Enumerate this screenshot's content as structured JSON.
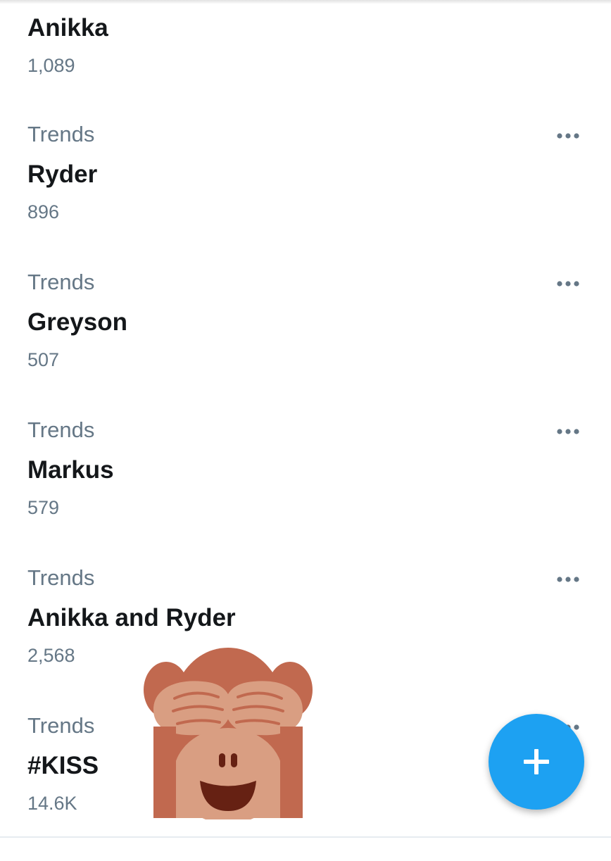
{
  "trends": [
    {
      "category": "",
      "name": "Anikka",
      "count": "1,089",
      "show_more": false
    },
    {
      "category": "Trends",
      "name": "Ryder",
      "count": "896",
      "show_more": true
    },
    {
      "category": "Trends",
      "name": "Greyson",
      "count": "507",
      "show_more": true
    },
    {
      "category": "Trends",
      "name": "Markus",
      "count": "579",
      "show_more": true
    },
    {
      "category": "Trends",
      "name": "Anikka and Ryder",
      "count": "2,568",
      "show_more": true
    },
    {
      "category": "Trends",
      "name": "#KISS",
      "count": "14.6K",
      "show_more": true
    }
  ],
  "icons": {
    "more": "more-horizontal-icon",
    "fab": "plus-icon",
    "emoji": "see-no-evil-monkey"
  },
  "colors": {
    "accent": "#1da1f2",
    "secondary_text": "#657786",
    "primary_text": "#14171a"
  }
}
